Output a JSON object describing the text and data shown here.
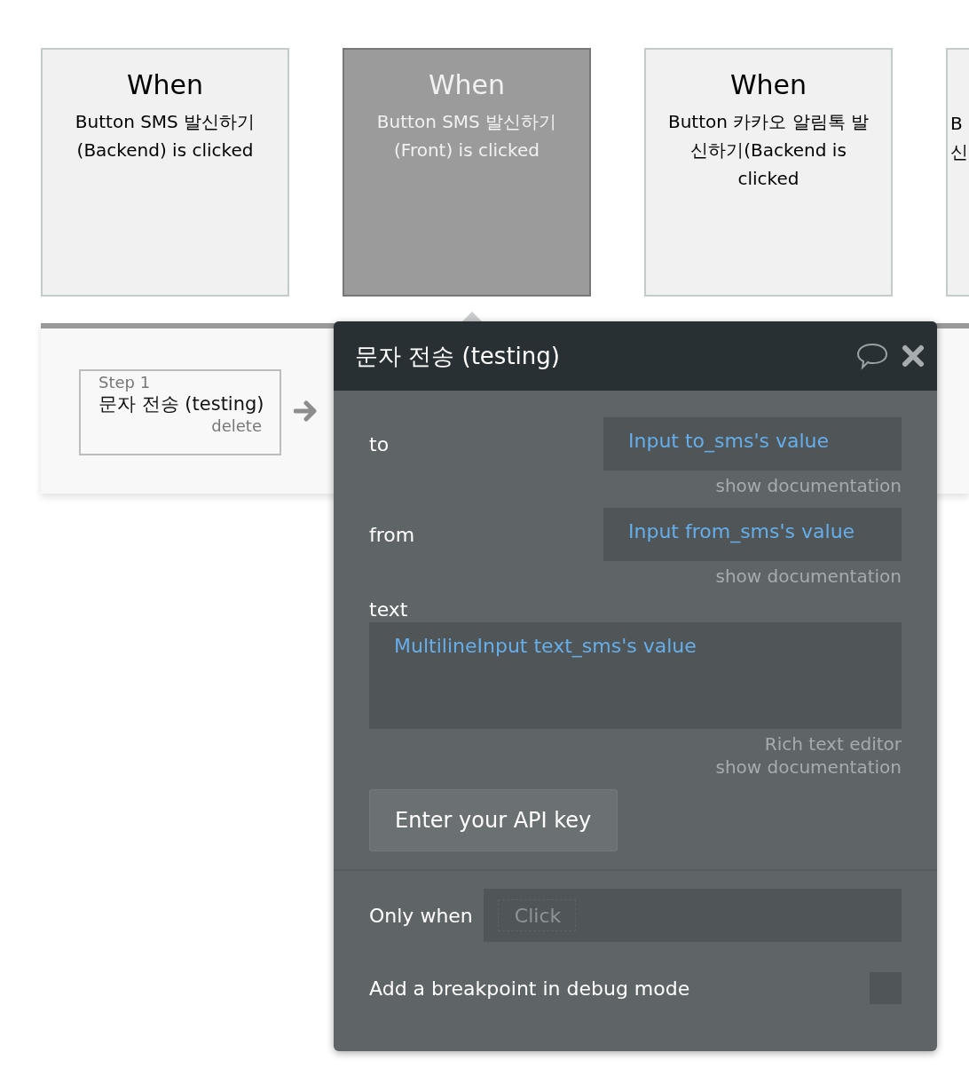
{
  "event_cards": [
    {
      "title": "When",
      "lines": [
        "Button SMS 발신하기",
        "(Backend) is clicked"
      ],
      "selected": false
    },
    {
      "title": "When",
      "lines": [
        "Button SMS 발신하기",
        "(Front) is clicked"
      ],
      "selected": true
    },
    {
      "title": "When",
      "lines": [
        "Button 카카오 알림톡 발",
        "신하기(Backend is",
        "clicked"
      ],
      "selected": false
    },
    {
      "lines": [
        "B",
        "신"
      ],
      "selected": false
    }
  ],
  "step": {
    "label": "Step 1",
    "name": "문자 전송 (testing)",
    "action": "delete"
  },
  "panel": {
    "title": "문자 전송 (testing)",
    "fields": [
      {
        "kind": "dynamic",
        "label": "to",
        "value": "Input to_sms's value",
        "links": [
          "show documentation"
        ]
      },
      {
        "kind": "dynamic",
        "label": "from",
        "value": "Input from_sms's value",
        "links": [
          "show documentation"
        ]
      },
      {
        "kind": "multiline",
        "label": "text",
        "value": "MultilineInput text_sms's value",
        "links": [
          "Rich text editor",
          "show documentation"
        ]
      }
    ],
    "api_button": "Enter your API key",
    "only_when": {
      "label": "Only when",
      "placeholder": "Click"
    },
    "breakpoint": {
      "label": "Add a breakpoint in debug mode",
      "checked": false
    }
  }
}
